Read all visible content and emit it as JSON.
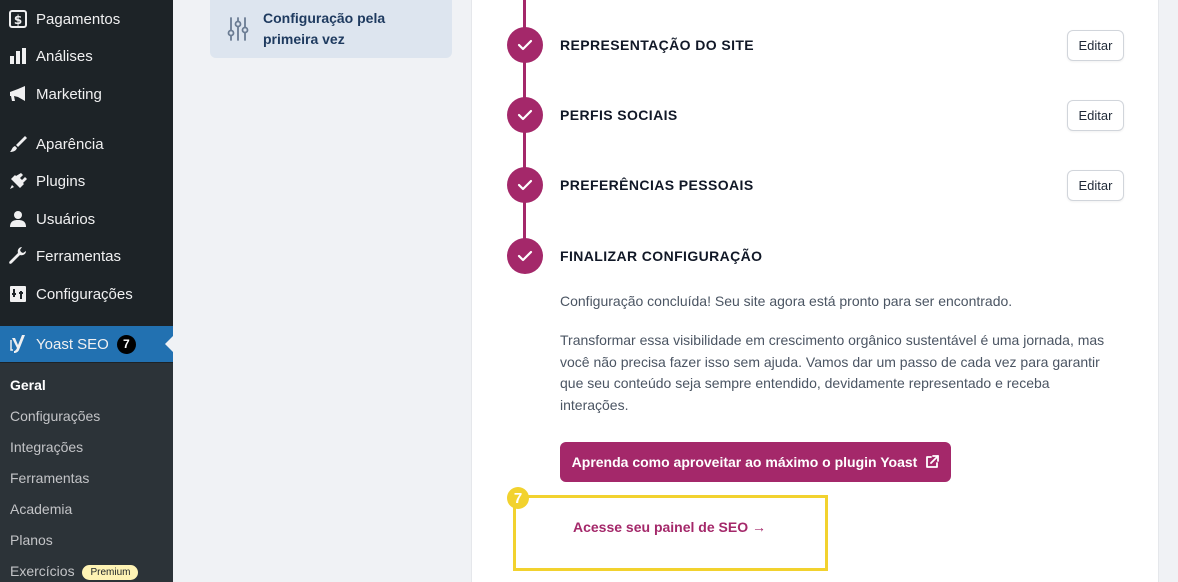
{
  "sidebar": {
    "items": [
      {
        "label": "Pagamentos",
        "icon": "dollar-icon"
      },
      {
        "label": "Análises",
        "icon": "bar-chart-icon"
      },
      {
        "label": "Marketing",
        "icon": "megaphone-icon"
      },
      {
        "label": "Aparência",
        "icon": "paintbrush-icon"
      },
      {
        "label": "Plugins",
        "icon": "plug-icon"
      },
      {
        "label": "Usuários",
        "icon": "user-icon"
      },
      {
        "label": "Ferramentas",
        "icon": "wrench-icon"
      },
      {
        "label": "Configurações",
        "icon": "settings-icon"
      }
    ],
    "yoast": {
      "label": "Yoast SEO",
      "badge": "7",
      "icon": "yoast-icon"
    },
    "submenu": [
      {
        "label": "Geral"
      },
      {
        "label": "Configurações"
      },
      {
        "label": "Integrações"
      },
      {
        "label": "Ferramentas"
      },
      {
        "label": "Academia"
      },
      {
        "label": "Planos"
      },
      {
        "label": "Exercícios",
        "pill": "Premium"
      }
    ]
  },
  "nav": {
    "label": "Configuração pela primeira vez",
    "icon": "sliders-icon"
  },
  "steps": [
    {
      "title": "REPRESENTAÇÃO DO SITE",
      "edit": "Editar"
    },
    {
      "title": "PERFIS SOCIAIS",
      "edit": "Editar"
    },
    {
      "title": "PREFERÊNCIAS PESSOAIS",
      "edit": "Editar"
    },
    {
      "title": "FINALIZAR CONFIGURAÇÃO"
    }
  ],
  "finish": {
    "p1": "Configuração concluída! Seu site agora está pronto para ser encontrado.",
    "p2": "Transformar essa visibilidade em crescimento orgânico sustentável é uma jornada, mas você não precisa fazer isso sem ajuda. Vamos dar um passo de cada vez para garantir que seu conteúdo seja sempre entendido, devidamente representado e receba interações.",
    "button": "Aprenda como aproveitar ao máximo o plugin Yoast",
    "link": "Acesse seu painel de SEO →"
  },
  "annotation": {
    "badge": "7"
  },
  "colors": {
    "brand": "#a4286a",
    "sidebar_bg": "#1d2327",
    "active": "#2271b1",
    "highlight": "#f2d22e"
  }
}
